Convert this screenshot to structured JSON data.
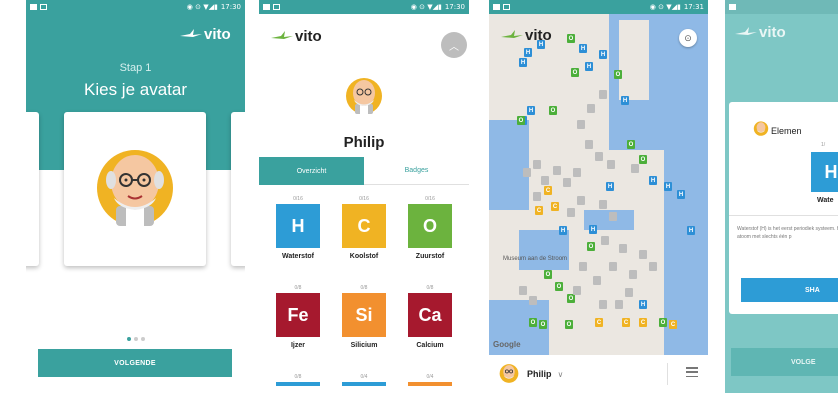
{
  "colors": {
    "teal": "#3aa19e",
    "hydrogen": "#2d9cd6",
    "carbon": "#f0b323",
    "oxygen": "#6cb33e",
    "iron": "#a6192e",
    "silicon": "#f2902f",
    "calcium": "#a6192e",
    "marker_blue": "#2d8fd6",
    "marker_green": "#4caf3a",
    "marker_orange": "#f0b323",
    "marker_gray": "#bdbdbd"
  },
  "statusbar": {
    "s1_time": "17:30",
    "s2_time": "17:30",
    "s3_time": "17:31"
  },
  "brand": {
    "logo_text": "vito"
  },
  "screen1": {
    "step": "Stap 1",
    "title": "Kies je avatar",
    "next_button": "VOLGENDE",
    "pagination": {
      "pages": 3,
      "current": 1
    }
  },
  "screen2": {
    "player_name": "Philip",
    "tabs": [
      {
        "label": "Overzicht",
        "active": true
      },
      {
        "label": "Badges",
        "active": false
      }
    ],
    "elements": [
      {
        "symbol": "H",
        "name": "Waterstof",
        "count": "0/16",
        "color": "#2d9cd6"
      },
      {
        "symbol": "C",
        "name": "Koolstof",
        "count": "0/16",
        "color": "#f0b323"
      },
      {
        "symbol": "O",
        "name": "Zuurstof",
        "count": "0/16",
        "color": "#6cb33e"
      },
      {
        "symbol": "Fe",
        "name": "Ijzer",
        "count": "0/8",
        "color": "#a6192e"
      },
      {
        "symbol": "Si",
        "name": "Silicium",
        "count": "0/8",
        "color": "#f2902f"
      },
      {
        "symbol": "Ca",
        "name": "Calcium",
        "count": "0/8",
        "color": "#a6192e"
      }
    ],
    "next_row_counts": [
      "0/8",
      "0/4",
      "0/4"
    ]
  },
  "screen3": {
    "user_name": "Philip",
    "map_labels": [
      "Museum aan de Stroom"
    ],
    "attribution": "Google",
    "marker_letters": {
      "hydrogen": "H",
      "carbon": "C",
      "oxygen": "O"
    }
  },
  "screen4": {
    "dialog_title": "Elemen",
    "element_symbol": "H",
    "element_name": "Wate",
    "count": "1/",
    "description": "Waterstof (H) is het eerst periodiek systeem. Het i atoom met slechts één p",
    "share_button": "SHA",
    "next_button": "VOLGE"
  }
}
